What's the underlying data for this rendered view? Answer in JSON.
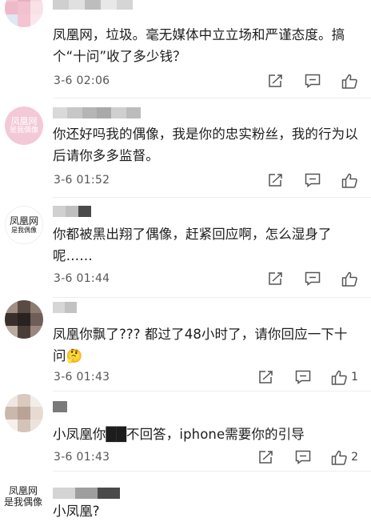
{
  "comments": [
    {
      "avatar": {
        "type": "mosaic",
        "colors": [
          "#f4c8d6",
          "#e8b0c2",
          "#f7d7e1",
          "#eeb9c8",
          "#f2c1d0",
          "#f9e1e8",
          "#dfe7f4",
          "#f3c4d2",
          "#fbe6ec"
        ]
      },
      "username_blocks": [
        "#cfcfcf",
        "#e0e0e0",
        "#bdbdbd",
        "#e8e8e8",
        "#d5d5d5"
      ],
      "text": "凤凰网，垃圾。毫无媒体中立立场和严谨态度。搞个“十问”收了多少钱？",
      "time": "3-6  02:06",
      "likes": ""
    },
    {
      "avatar": {
        "type": "text",
        "line1": "凤凰网",
        "line2": "是我偶像",
        "bg": "#f3c9d7",
        "color": "#ffffff"
      },
      "username_blocks": [
        "#d9d9d9",
        "#c7c7c7",
        "#b5b5b5",
        "#a9a9a9",
        "#cfcfcf",
        "#bcbcbc"
      ],
      "text": "你还好吗我的偶像，我是你的忠实粉丝，我的行为以后请你多多监督。",
      "time": "3-6  01:52",
      "likes": ""
    },
    {
      "avatar": {
        "type": "text",
        "line1": "凤凰网",
        "line2": "是我偶像",
        "bg": "#ffffff",
        "color": "#222222"
      },
      "username_blocks": [
        "#d0d0d0",
        "#bfbfbf",
        "#4a4a4a"
      ],
      "text": "你都被黑出翔了偶像，赶紧回应啊，怎么湿身了呢……",
      "time": "3-6  01:44",
      "likes": ""
    },
    {
      "avatar": {
        "type": "mosaic",
        "colors": [
          "#a08f86",
          "#5a4a44",
          "#8d7b72",
          "#3b2f2b",
          "#2a2220",
          "#6f5e57",
          "#b9aaa2",
          "#4b3d38",
          "#9a8880"
        ]
      },
      "username_blocks": [
        "#d6d6d6",
        "#c2c2c2"
      ],
      "text": "凤凰你飘了??? 都过了48小时了，请你回应一下十问🤔",
      "time": "3-6  01:43",
      "likes": "1"
    },
    {
      "avatar": {
        "type": "mosaic",
        "colors": [
          "#efe7e1",
          "#d9c9bf",
          "#f3ede8",
          "#cbb8ac",
          "#b9a396",
          "#e6dad2",
          "#f5f0ec",
          "#d3c3b8",
          "#ece3dc"
        ]
      },
      "username_blocks": [
        "#7a7a7a"
      ],
      "text": "小凤凰你██不回答，iphone需要你的引导",
      "time": "3-6  01:43",
      "likes": "2"
    },
    {
      "avatar": {
        "type": "text",
        "line1": "凤凰网",
        "line2": "是我偶像",
        "bg": "#ffffff",
        "color": "#222222"
      },
      "username_blocks": [
        "#d4d4d4",
        "#9e9e9e",
        "#4a4a4a"
      ],
      "text": "小凤凰?",
      "time": "",
      "likes": ""
    }
  ],
  "icons": {
    "share": "share-icon",
    "reply": "reply-icon",
    "like": "thumbs-up-icon"
  }
}
